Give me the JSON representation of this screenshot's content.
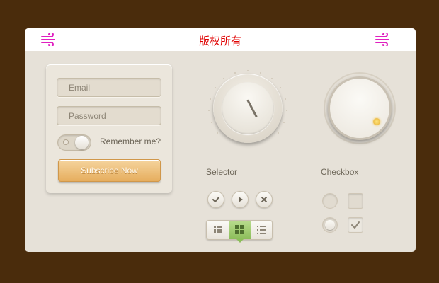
{
  "header": {
    "title": "版权所有",
    "left_icon": "wind-icon",
    "right_icon": "wind-icon"
  },
  "form": {
    "email_placeholder": "Email",
    "password_placeholder": "Password",
    "remember_label": "Remember me?",
    "remember_on": false,
    "subscribe_label": "Subscribe Now"
  },
  "selector": {
    "label": "Selector",
    "buttons": [
      "check-icon",
      "play-icon",
      "close-icon"
    ],
    "view_modes": [
      "small-grid-icon",
      "large-grid-icon",
      "list-icon"
    ],
    "selected_view": "large-grid-icon"
  },
  "checkbox": {
    "label": "Checkbox",
    "radios": [
      false,
      true
    ],
    "checkboxes": [
      false,
      true
    ]
  },
  "colors": {
    "background": "#4a2c0c",
    "panel": "#e6e1d8",
    "title_red": "#e00000",
    "icon_magenta": "#e020c0",
    "subscribe_orange": "#e6ae5e",
    "selected_green": "#8cbe5a",
    "led_yellow": "#e4a92d"
  }
}
